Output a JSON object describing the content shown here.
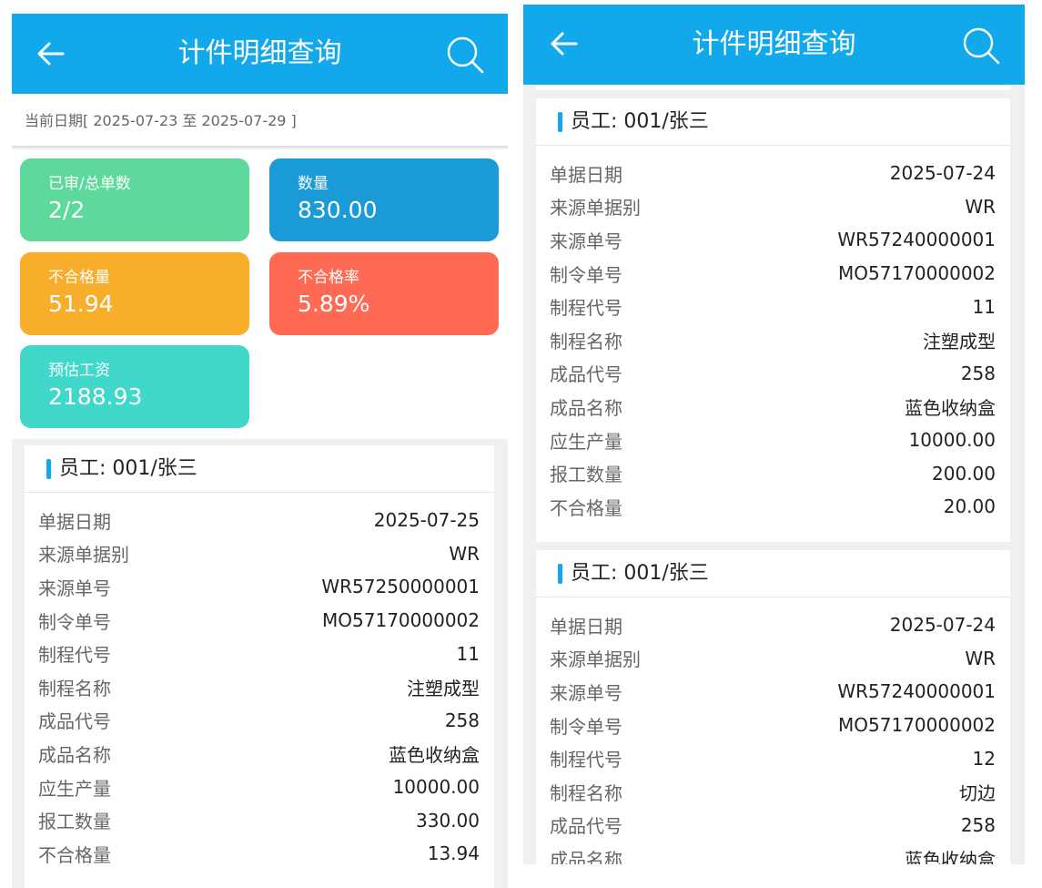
{
  "header": {
    "title": "计件明细查询"
  },
  "date_range": "当前日期[ 2025-07-23 至 2025-07-29 ]",
  "stats": [
    {
      "label": "已审/总单数",
      "value": "2/2",
      "color": "#5dd99b"
    },
    {
      "label": "数量",
      "value": "830.00",
      "color": "#1a9ad6"
    },
    {
      "label": "不合格量",
      "value": "51.94",
      "color": "#f9ae2b"
    },
    {
      "label": "不合格率",
      "value": "5.89%",
      "color": "#fe6a53"
    },
    {
      "label": "预估工资",
      "value": "2188.93",
      "color": "#3fd8cb"
    }
  ],
  "field_labels": [
    "单据日期",
    "来源单据别",
    "来源单号",
    "制令单号",
    "制程代号",
    "制程名称",
    "成品代号",
    "成品名称",
    "应生产量",
    "报工数量",
    "不合格量"
  ],
  "cards": [
    {
      "employee": "员工: 001/张三",
      "values": [
        "2025-07-25",
        "WR",
        "WR57250000001",
        "MO57170000002",
        "11",
        "注塑成型",
        "258",
        "蓝色收纳盒",
        "10000.00",
        "330.00",
        "13.94"
      ]
    },
    {
      "employee": "员工: 001/张三",
      "values": [
        "2025-07-24",
        "WR",
        "WR57240000001",
        "MO57170000002",
        "11",
        "注塑成型",
        "258",
        "蓝色收纳盒",
        "10000.00",
        "200.00",
        "20.00"
      ]
    },
    {
      "employee": "员工: 001/张三",
      "values": [
        "2025-07-24",
        "WR",
        "WR57240000001",
        "MO57170000002",
        "12",
        "切边",
        "258",
        "蓝色收纳盒"
      ]
    }
  ]
}
